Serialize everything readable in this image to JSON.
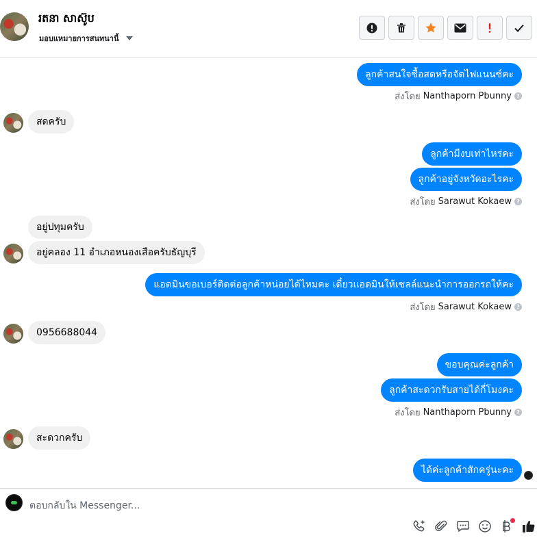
{
  "header": {
    "name": "រតនា សាស៊ូប",
    "subtitle": "มอบแหมายการสนทนานี้",
    "actions": [
      {
        "icon": "alert-circle-icon"
      },
      {
        "icon": "trash-icon"
      },
      {
        "icon": "star-icon"
      },
      {
        "icon": "mail-icon"
      },
      {
        "icon": "exclamation-icon"
      },
      {
        "icon": "check-icon"
      }
    ]
  },
  "messages": {
    "m1": "ลูกค้าสนใจซื้อสดหรือจัดไฟแนนซ์คะ",
    "m1_by_prefix": "ส่งโดย",
    "m1_by": "Nanthaporn Pbunny",
    "m2": "สดครับ",
    "m3": "ลูกค้ามีงบเท่าไหร่คะ",
    "m4": "ลูกค้าอยู่จังหวัดอะไรคะ",
    "m4_by_prefix": "ส่งโดย",
    "m4_by": "Sarawut Kokaew",
    "m5": "อยู่ปทุมครับ",
    "m6": "อยู่คลอง 11 อำเภอหนองเสือครับธัญบุรี",
    "m7": "แอดมินขอเบอร์ติดต่อลูกค้าหน่อยได้ไหมคะ เดี๋ยวแอดมินให้เซลล์แนะนำการออกรถให้คะ",
    "m7_by_prefix": "ส่งโดย",
    "m7_by": "Sarawut Kokaew",
    "m8": "0956688044",
    "m9": "ขอบคุณค่ะลูกค้า",
    "m10": "ลูกค้าสะดวกรับสายได้กี่โมงคะ",
    "m10_by_prefix": "ส่งโดย",
    "m10_by": "Nanthaporn Pbunny",
    "m11": "สะดวกครับ",
    "m12": "ได้ค่ะลูกค้าสักครู่นะคะ"
  },
  "composer": {
    "placeholder": "ตอบกลับใน Messenger...",
    "tools": [
      "phone-add-icon",
      "paperclip-icon",
      "chat-icon",
      "emoji-icon",
      "baht-icon",
      "like-icon"
    ]
  },
  "colors": {
    "outgoing_bubble": "#0084ff",
    "incoming_bubble": "#f0f0f0",
    "star": "#f5821f",
    "exclamation": "#e02020"
  }
}
